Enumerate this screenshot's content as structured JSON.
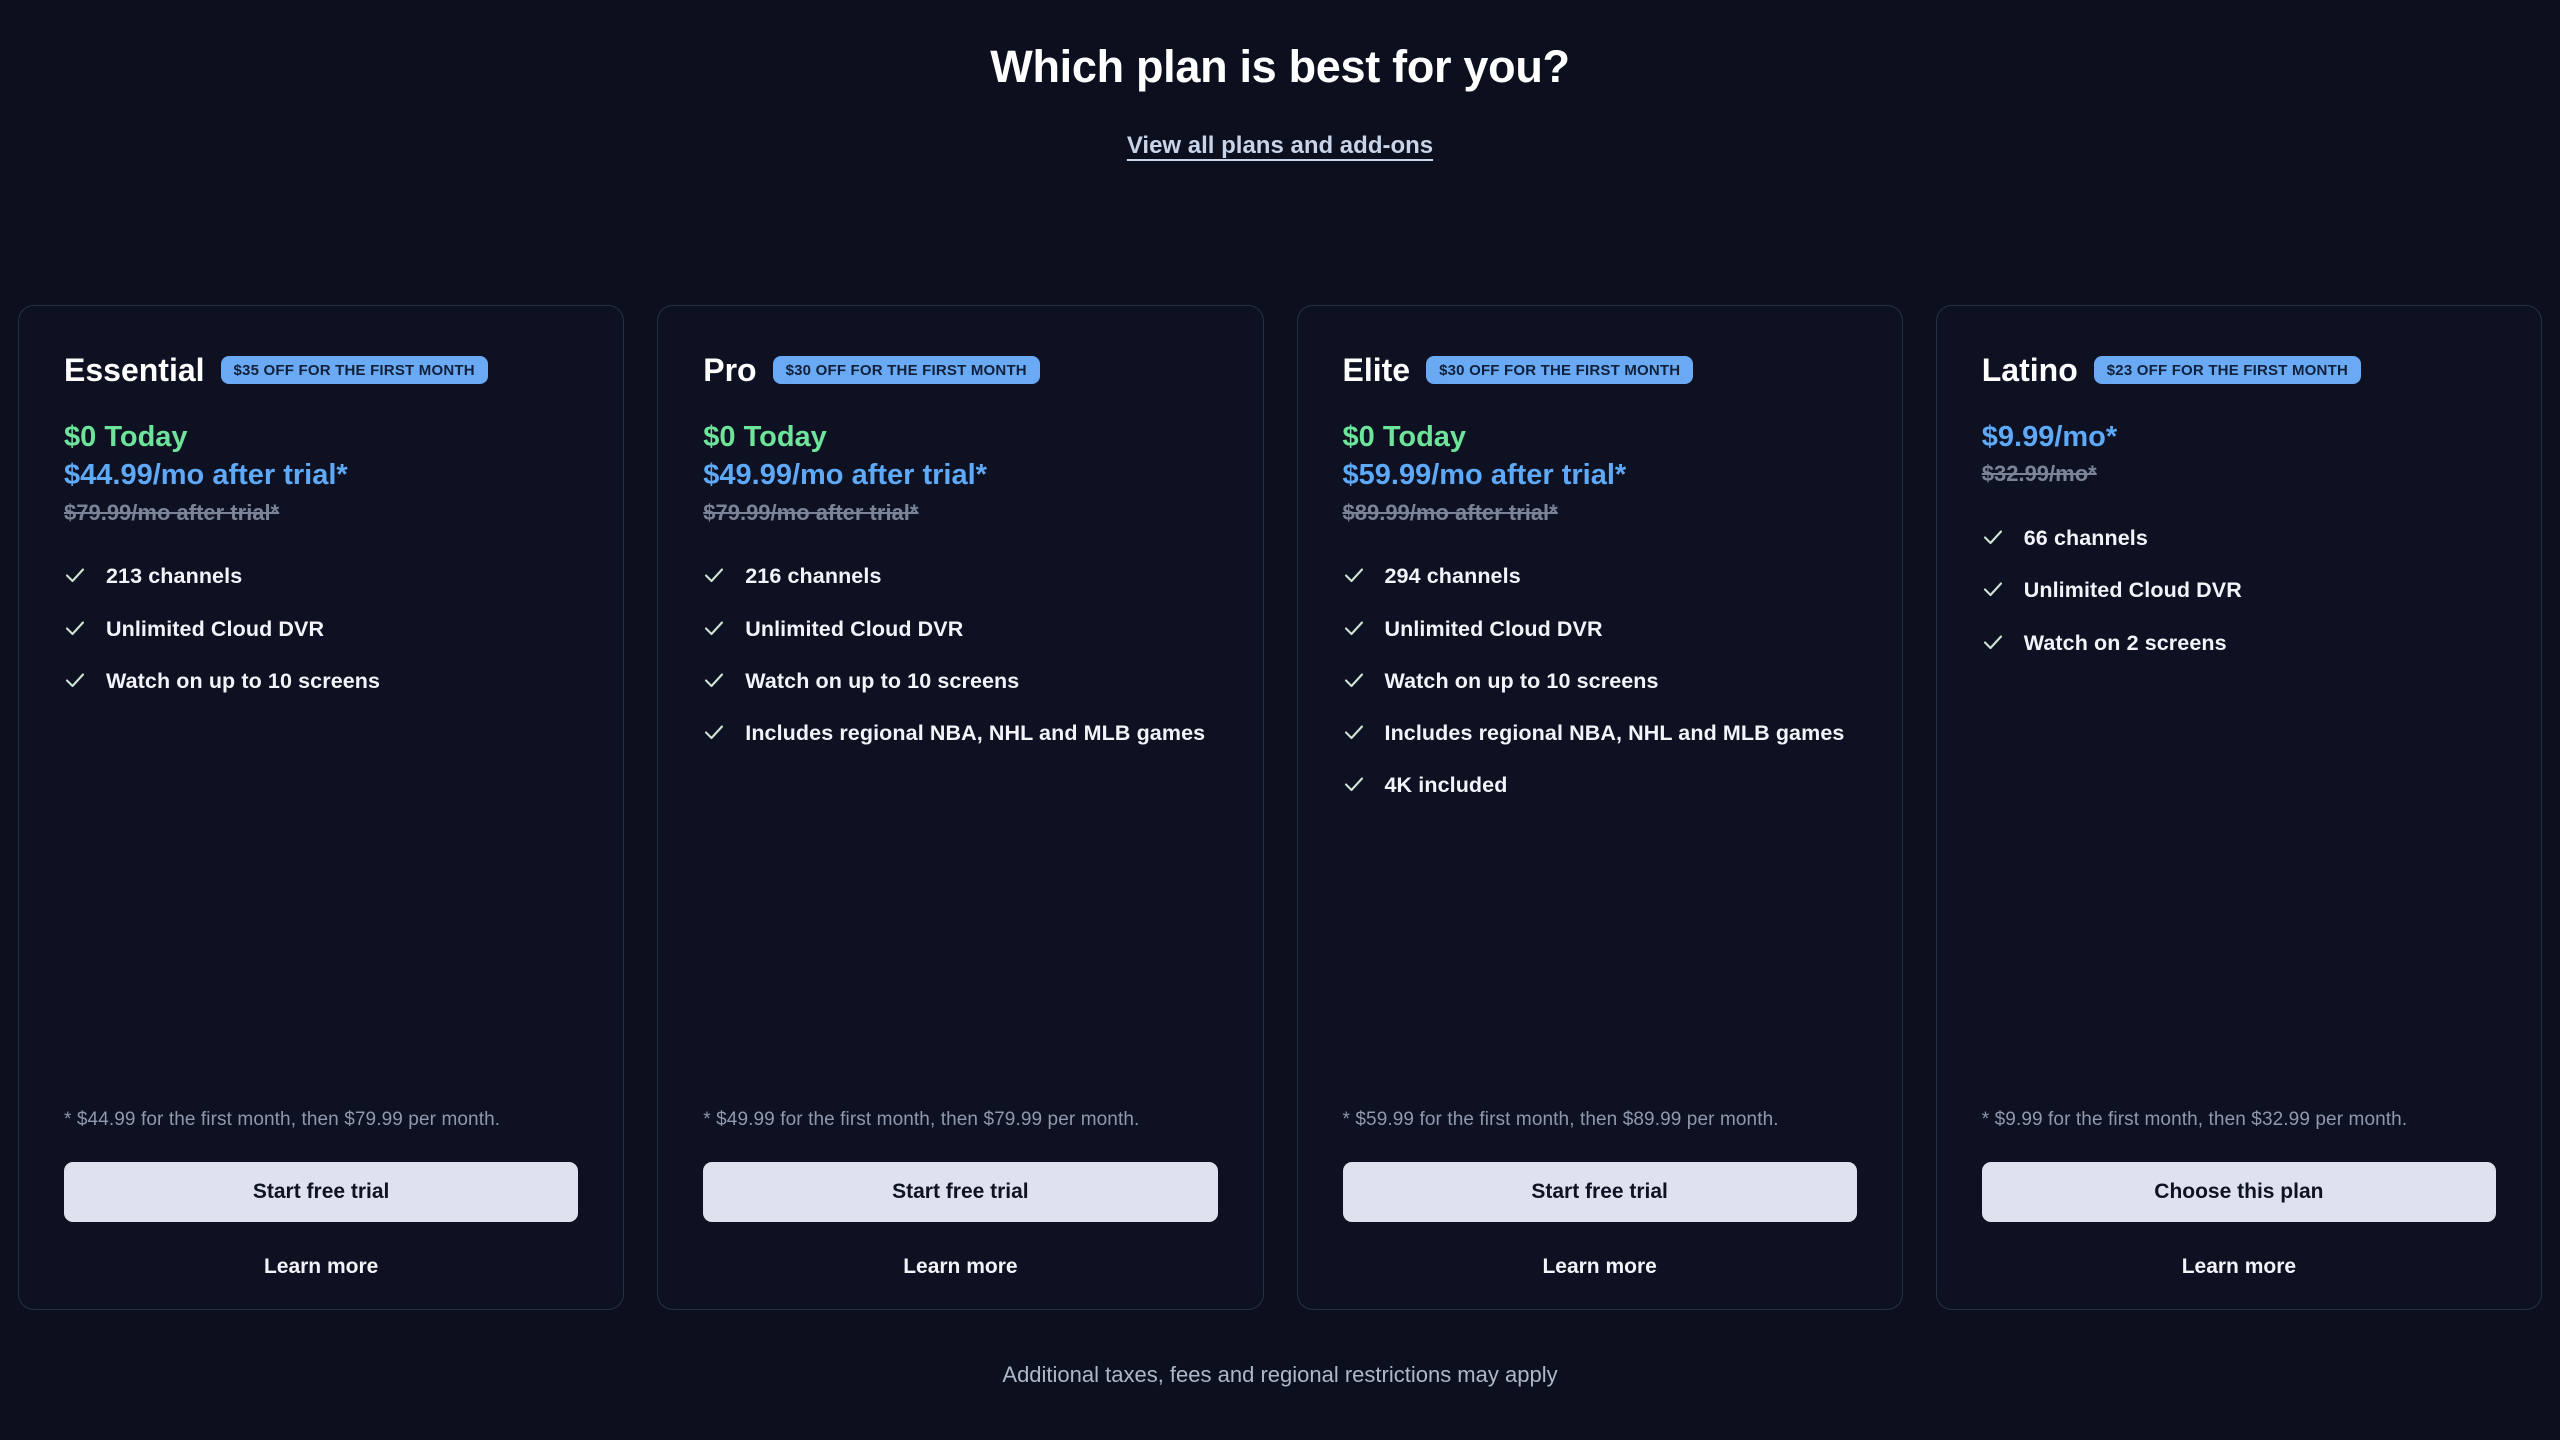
{
  "header": {
    "title": "Which plan is best for you?",
    "link_label": "View all plans and add-ons"
  },
  "colors": {
    "background": "#0c0f1e",
    "card_background": "#0d1122",
    "card_border": "#2a2f45",
    "badge_background": "#6aaaf5",
    "badge_text": "#11203a",
    "price_today": "#6de49a",
    "price_main": "#5ea9f8",
    "price_old": "#7b8398",
    "button_background": "#dfe1ef",
    "button_text": "#0e1323",
    "check_icon": "#cfe3d4"
  },
  "icons": {
    "check": "check-icon"
  },
  "plans": [
    {
      "name": "Essential",
      "badge": "$35 OFF FOR THE FIRST MONTH",
      "price_today": "$0 Today",
      "price_main": "$44.99/mo after trial*",
      "price_old": "$79.99/mo after trial*",
      "features": [
        "213 channels",
        "Unlimited Cloud DVR",
        "Watch on up to 10 screens"
      ],
      "disclaimer": "* $44.99 for the first month, then $79.99 per month.",
      "cta": "Start free trial",
      "learn_more": "Learn more"
    },
    {
      "name": "Pro",
      "badge": "$30 OFF FOR THE FIRST MONTH",
      "price_today": "$0 Today",
      "price_main": "$49.99/mo after trial*",
      "price_old": "$79.99/mo after trial*",
      "features": [
        "216 channels",
        "Unlimited Cloud DVR",
        "Watch on up to 10 screens",
        "Includes regional NBA, NHL and MLB games"
      ],
      "disclaimer": "* $49.99 for the first month, then $79.99 per month.",
      "cta": "Start free trial",
      "learn_more": "Learn more"
    },
    {
      "name": "Elite",
      "badge": "$30 OFF FOR THE FIRST MONTH",
      "price_today": "$0 Today",
      "price_main": "$59.99/mo after trial*",
      "price_old": "$89.99/mo after trial*",
      "features": [
        "294 channels",
        "Unlimited Cloud DVR",
        "Watch on up to 10 screens",
        "Includes regional NBA, NHL and MLB games",
        "4K included"
      ],
      "disclaimer": "* $59.99 for the first month, then $89.99 per month.",
      "cta": "Start free trial",
      "learn_more": "Learn more"
    },
    {
      "name": "Latino",
      "badge": "$23 OFF FOR THE FIRST MONTH",
      "price_today": "",
      "price_main": "$9.99/mo*",
      "price_old": "$32.99/mo*",
      "features": [
        "66 channels",
        "Unlimited Cloud DVR",
        "Watch on 2 screens"
      ],
      "disclaimer": "* $9.99 for the first month, then $32.99 per month.",
      "cta": "Choose this plan",
      "learn_more": "Learn more"
    }
  ],
  "footer": {
    "note": "Additional taxes, fees and regional restrictions may apply"
  }
}
